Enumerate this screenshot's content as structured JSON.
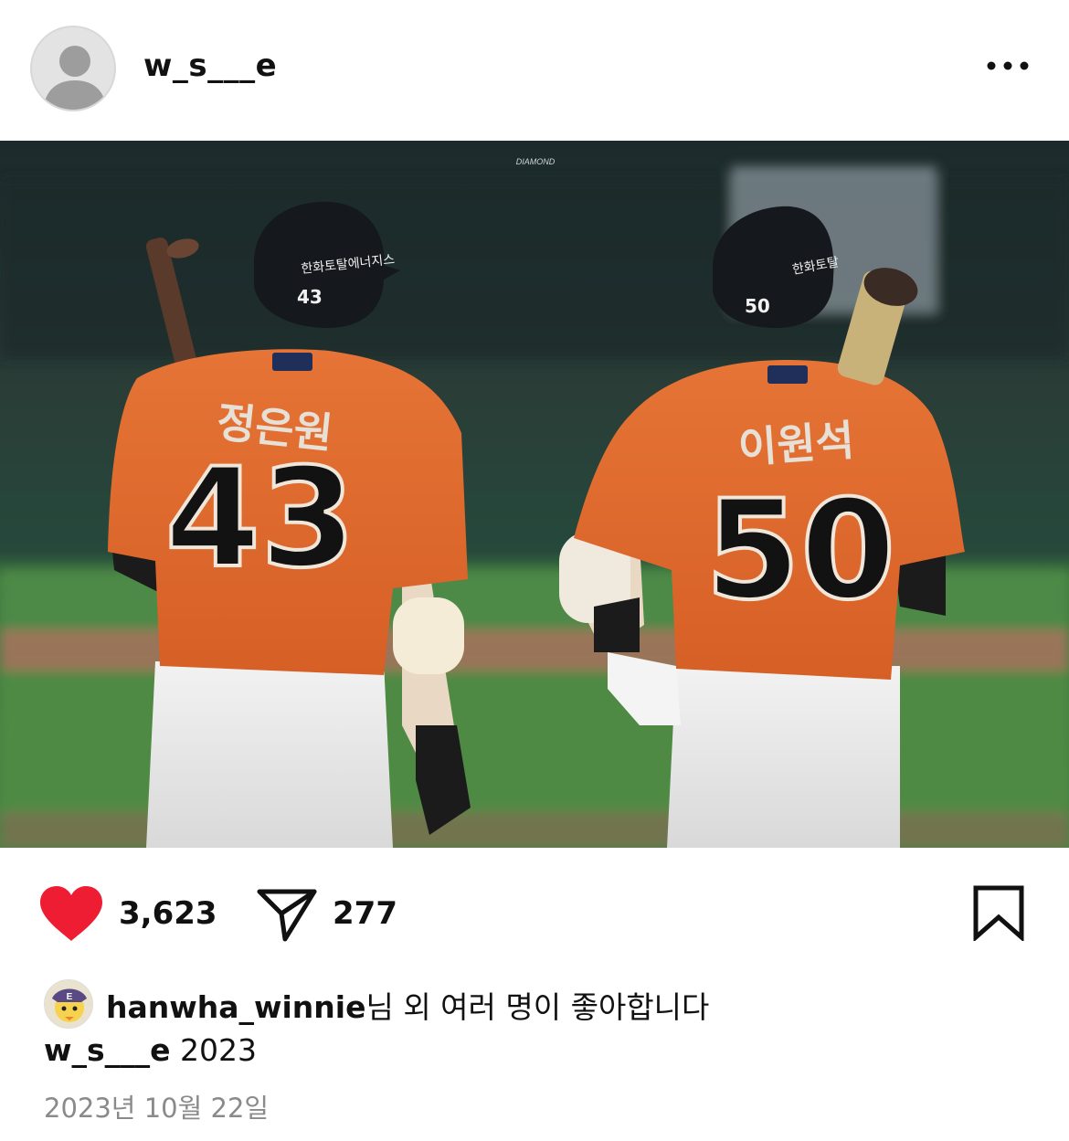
{
  "post": {
    "username": "w_s___e",
    "avatar_icon": "default-profile-icon",
    "more_icon": "more-horizontal-icon"
  },
  "photo": {
    "watermark": "DIAMOND",
    "players": [
      {
        "number": "43",
        "name": "정은원",
        "helmet_number": "43",
        "helmet_text": "한화토탈에너지스"
      },
      {
        "number": "50",
        "name": "이원석",
        "helmet_number": "50",
        "helmet_text": "한화토탈"
      }
    ]
  },
  "actions": {
    "like_count": "3,623",
    "share_count": "277",
    "like_icon": "heart-filled-icon",
    "share_icon": "send-icon",
    "bookmark_icon": "bookmark-icon",
    "like_color": "#ee1d33"
  },
  "liked_by": {
    "name": "hanwha_winnie",
    "rest": "님 외 여러 명이 좋아합니다"
  },
  "caption": {
    "username": "w_s___e",
    "text": " 2023"
  },
  "date": "2023년 10월 22일"
}
